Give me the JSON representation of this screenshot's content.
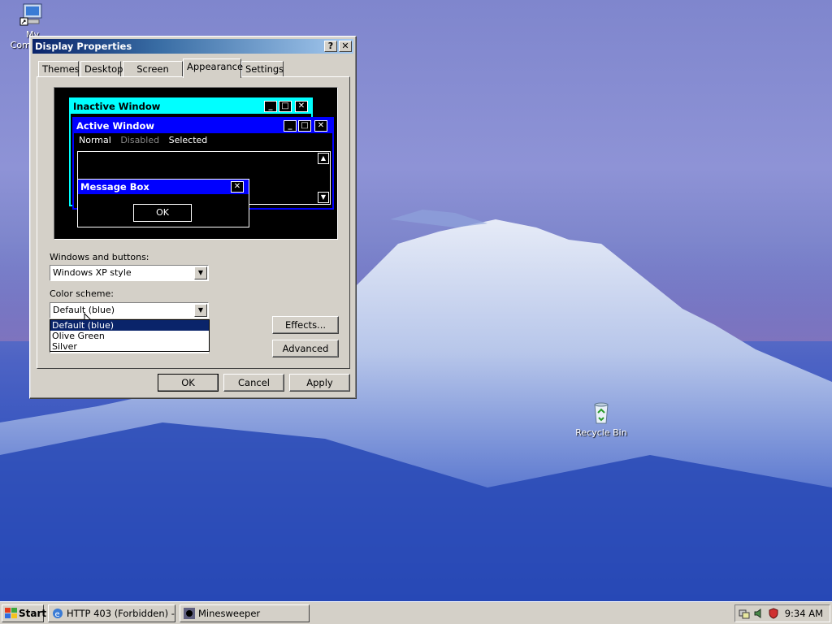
{
  "desktop": {
    "icons": [
      {
        "label": "My Computer"
      },
      {
        "label": "Recycle Bin"
      }
    ]
  },
  "dialog": {
    "title": "Display Properties",
    "help_btn": "?",
    "close_btn": "✕",
    "tabs": [
      {
        "label": "Themes"
      },
      {
        "label": "Desktop"
      },
      {
        "label": "Screen Saver"
      },
      {
        "label": "Appearance",
        "active": true
      },
      {
        "label": "Settings"
      }
    ],
    "preview": {
      "inactive_title": "Inactive Window",
      "active_title": "Active Window",
      "menu": [
        "Normal",
        "Disabled",
        "Selected"
      ],
      "message_title": "Message Box",
      "ok_label": "OK"
    },
    "windows_buttons_label": "Windows and buttons:",
    "windows_buttons_value": "Windows XP style",
    "color_scheme_label": "Color scheme:",
    "color_scheme_value": "Default (blue)",
    "color_scheme_options": [
      "Default (blue)",
      "Olive Green",
      "Silver"
    ],
    "effects_label": "Effects...",
    "advanced_label": "Advanced",
    "ok_label": "OK",
    "cancel_label": "Cancel",
    "apply_label": "Apply"
  },
  "taskbar": {
    "start_label": "Start",
    "tasks": [
      {
        "label": "HTTP 403 (Forbidden) - ..."
      },
      {
        "label": "Minesweeper"
      }
    ],
    "clock": "9:34 AM"
  },
  "colors": {
    "preview_inactive_title": "#00ffff",
    "preview_active_title": "#0000ff",
    "dialog_face": "#d4d0c8",
    "selection": "#0a246a"
  }
}
